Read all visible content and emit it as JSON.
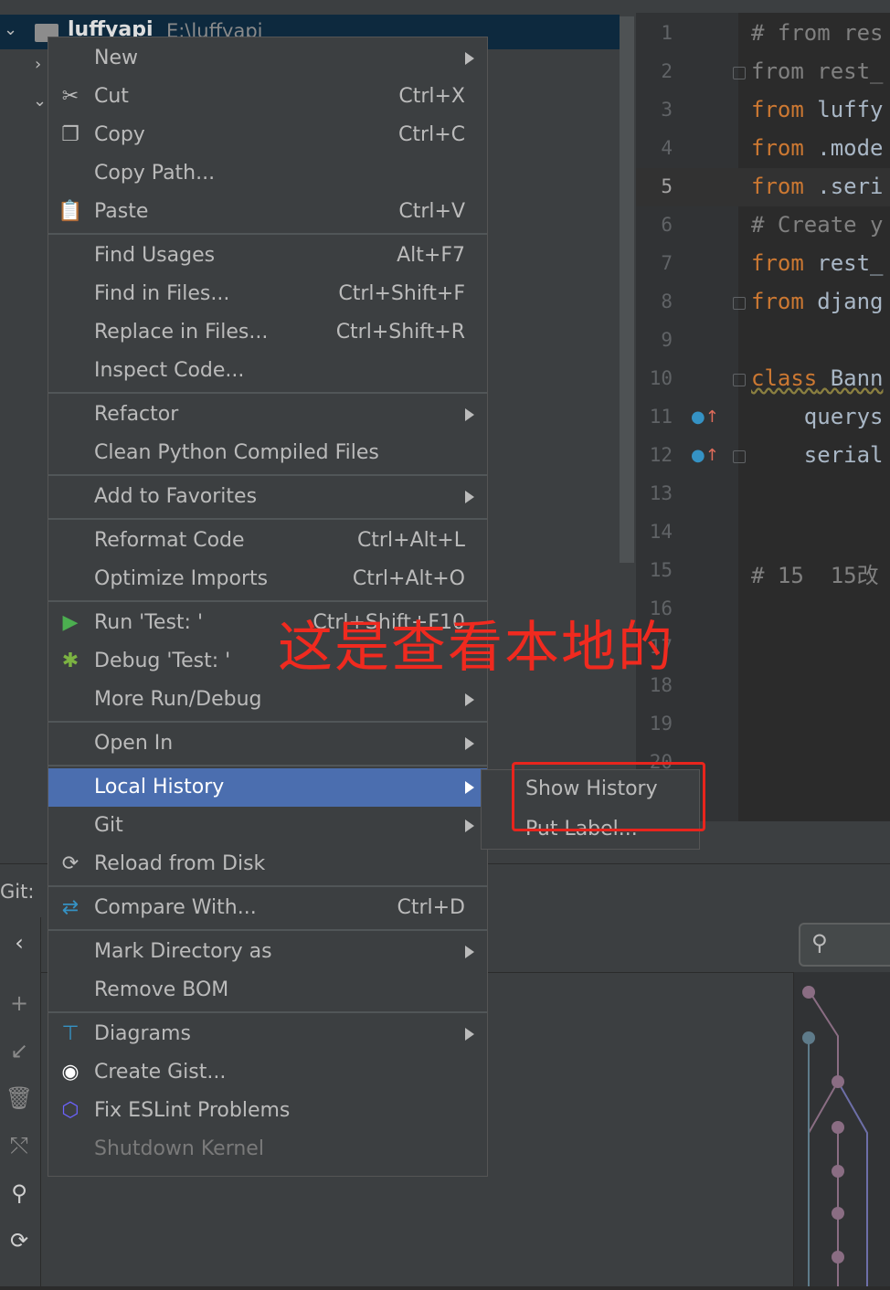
{
  "project": {
    "root_name": "luffyapi",
    "root_path": "E:\\luffyapi"
  },
  "editor": {
    "lines": [
      {
        "num": "1",
        "tokens": [
          {
            "t": "# from res",
            "c": "cm"
          }
        ]
      },
      {
        "num": "2",
        "tokens": [
          {
            "t": "from rest_",
            "c": "cm"
          }
        ]
      },
      {
        "num": "3",
        "tokens": [
          {
            "t": "from",
            "c": "kw"
          },
          {
            "t": " luffy",
            "c": ""
          }
        ]
      },
      {
        "num": "4",
        "tokens": [
          {
            "t": "from",
            "c": "kw"
          },
          {
            "t": " .mode",
            "c": ""
          }
        ]
      },
      {
        "num": "5",
        "tokens": [
          {
            "t": "from",
            "c": "kw"
          },
          {
            "t": " .seri",
            "c": ""
          }
        ]
      },
      {
        "num": "6",
        "tokens": [
          {
            "t": "# Create y",
            "c": "cm"
          }
        ]
      },
      {
        "num": "7",
        "tokens": [
          {
            "t": "from",
            "c": "kw"
          },
          {
            "t": " rest_",
            "c": ""
          }
        ]
      },
      {
        "num": "8",
        "tokens": [
          {
            "t": "from",
            "c": "kw"
          },
          {
            "t": " djang",
            "c": ""
          }
        ]
      },
      {
        "num": "9",
        "tokens": []
      },
      {
        "num": "10",
        "tokens": [
          {
            "t": "class",
            "c": "kw sq"
          },
          {
            "t": " Bann",
            "c": "sq"
          }
        ]
      },
      {
        "num": "11",
        "tokens": [
          {
            "t": "    querys",
            "c": ""
          }
        ]
      },
      {
        "num": "12",
        "tokens": [
          {
            "t": "    serial",
            "c": ""
          }
        ]
      },
      {
        "num": "13",
        "tokens": []
      },
      {
        "num": "14",
        "tokens": []
      },
      {
        "num": "15",
        "tokens": [
          {
            "t": "# 15  15改",
            "c": "cm"
          }
        ]
      },
      {
        "num": "16",
        "tokens": []
      },
      {
        "num": "17",
        "tokens": []
      },
      {
        "num": "18",
        "tokens": []
      },
      {
        "num": "19",
        "tokens": []
      },
      {
        "num": "20",
        "tokens": []
      }
    ]
  },
  "git": {
    "label": "Git:"
  },
  "context_menu": {
    "items": [
      {
        "label": "New",
        "shortcut": "",
        "submenu": true,
        "icon": ""
      },
      {
        "label": "Cut",
        "shortcut": "Ctrl+X",
        "submenu": false,
        "icon": "scissors-icon"
      },
      {
        "label": "Copy",
        "shortcut": "Ctrl+C",
        "submenu": false,
        "icon": "copy-icon"
      },
      {
        "label": "Copy Path...",
        "shortcut": "",
        "submenu": false,
        "icon": ""
      },
      {
        "label": "Paste",
        "shortcut": "Ctrl+V",
        "submenu": false,
        "icon": "clipboard-icon"
      },
      {
        "label": "Find Usages",
        "shortcut": "Alt+F7",
        "submenu": false,
        "icon": ""
      },
      {
        "label": "Find in Files...",
        "shortcut": "Ctrl+Shift+F",
        "submenu": false,
        "icon": ""
      },
      {
        "label": "Replace in Files...",
        "shortcut": "Ctrl+Shift+R",
        "submenu": false,
        "icon": ""
      },
      {
        "label": "Inspect Code...",
        "shortcut": "",
        "submenu": false,
        "icon": ""
      },
      {
        "label": "Refactor",
        "shortcut": "",
        "submenu": true,
        "icon": ""
      },
      {
        "label": "Clean Python Compiled Files",
        "shortcut": "",
        "submenu": false,
        "icon": ""
      },
      {
        "label": "Add to Favorites",
        "shortcut": "",
        "submenu": true,
        "icon": ""
      },
      {
        "label": "Reformat Code",
        "shortcut": "Ctrl+Alt+L",
        "submenu": false,
        "icon": ""
      },
      {
        "label": "Optimize Imports",
        "shortcut": "Ctrl+Alt+O",
        "submenu": false,
        "icon": ""
      },
      {
        "label": "Run 'Test: '",
        "shortcut": "Ctrl+Shift+F10",
        "submenu": false,
        "icon": "run-icon"
      },
      {
        "label": "Debug 'Test: '",
        "shortcut": "",
        "submenu": false,
        "icon": "bug-icon"
      },
      {
        "label": "More Run/Debug",
        "shortcut": "",
        "submenu": true,
        "icon": ""
      },
      {
        "label": "Open In",
        "shortcut": "",
        "submenu": true,
        "icon": ""
      },
      {
        "label": "Local History",
        "shortcut": "",
        "submenu": true,
        "icon": "",
        "selected": true
      },
      {
        "label": "Git",
        "shortcut": "",
        "submenu": true,
        "icon": ""
      },
      {
        "label": "Reload from Disk",
        "shortcut": "",
        "submenu": false,
        "icon": "reload-icon"
      },
      {
        "label": "Compare With...",
        "shortcut": "Ctrl+D",
        "submenu": false,
        "icon": "compare-icon"
      },
      {
        "label": "Mark Directory as",
        "shortcut": "",
        "submenu": true,
        "icon": ""
      },
      {
        "label": "Remove BOM",
        "shortcut": "",
        "submenu": false,
        "icon": ""
      },
      {
        "label": "Diagrams",
        "shortcut": "",
        "submenu": true,
        "icon": "diagram-icon"
      },
      {
        "label": "Create Gist...",
        "shortcut": "",
        "submenu": false,
        "icon": "github-icon"
      },
      {
        "label": "Fix ESLint Problems",
        "shortcut": "",
        "submenu": false,
        "icon": "eslint-icon"
      },
      {
        "label": "Shutdown Kernel",
        "shortcut": "",
        "submenu": false,
        "icon": "",
        "disabled": true
      }
    ]
  },
  "local_history_submenu": {
    "items": [
      "Show History",
      "Put Label..."
    ]
  },
  "annotation": {
    "text": "这是查看本地的"
  },
  "colors": {
    "menu_bg": "#3c3f41",
    "selection": "#4b6eaf",
    "keyword": "#cc7832",
    "comment": "#808080",
    "annotation_red": "#f02a1f"
  }
}
